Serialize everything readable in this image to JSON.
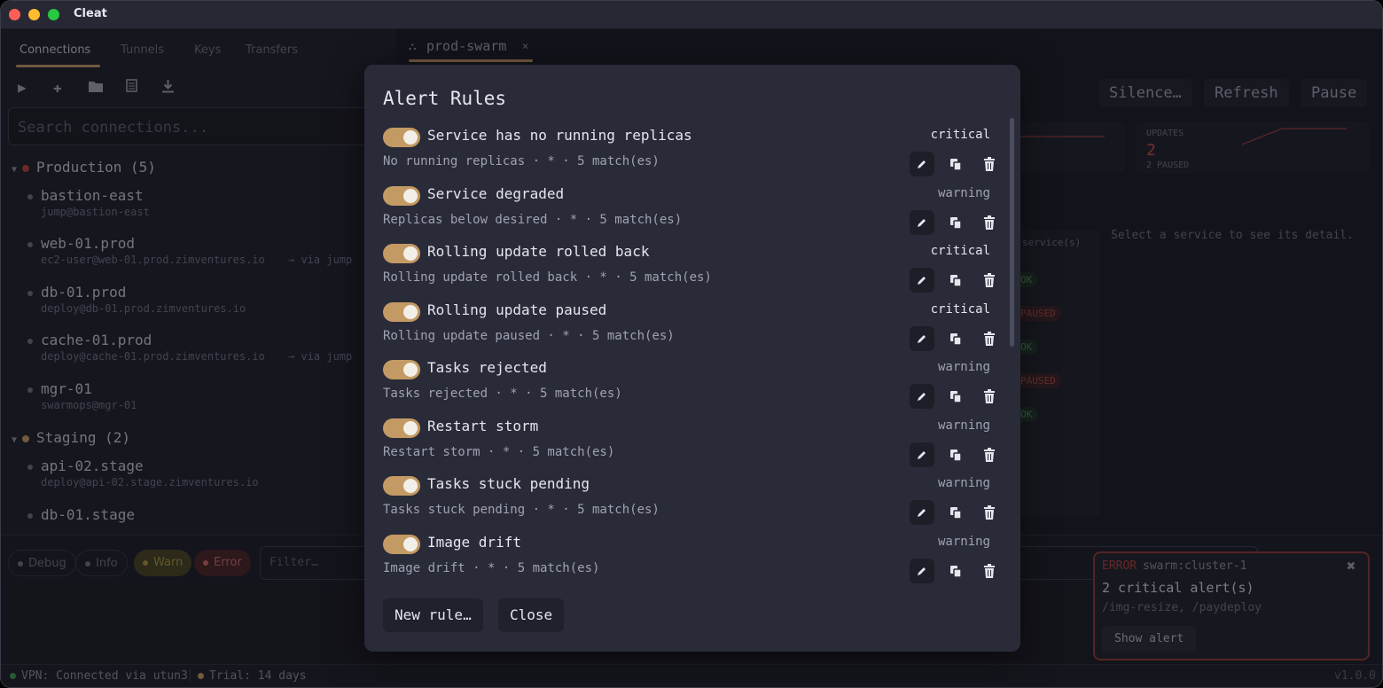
{
  "app": {
    "title": "Cleat"
  },
  "sidebar": {
    "tabs": [
      "Connections",
      "Tunnels",
      "Keys",
      "Transfers"
    ],
    "tools": [
      "play-icon",
      "plus-icon",
      "folder-icon",
      "document-icon",
      "download-icon"
    ],
    "search_placeholder": "Search connections...",
    "groups": [
      {
        "label": "Production (5)",
        "color": "#b5463f"
      },
      {
        "label": "Staging (2)",
        "color": "#c49a64"
      }
    ],
    "connections": [
      {
        "name": "bastion-east",
        "sub": "jump@bastion-east",
        "via": ""
      },
      {
        "name": "web-01.prod",
        "sub": "ec2-user@web-01.prod.zimventures.io",
        "via": "→ via jump"
      },
      {
        "name": "db-01.prod",
        "sub": "deploy@db-01.prod.zimventures.io",
        "via": ""
      },
      {
        "name": "cache-01.prod",
        "sub": "deploy@cache-01.prod.zimventures.io",
        "via": "→ via jump"
      },
      {
        "name": "mgr-01",
        "sub": "swarmops@mgr-01",
        "via": ""
      },
      {
        "name": "api-02.stage",
        "sub": "deploy@api-02.stage.zimventures.io",
        "via": ""
      },
      {
        "name": "db-01.stage",
        "sub": "",
        "via": ""
      }
    ]
  },
  "main": {
    "tab_label": "prod-swarm",
    "tab_close": "×",
    "buttons": [
      "Silence…",
      "Refresh",
      "Pause"
    ],
    "updates": {
      "label": "UPDATES",
      "value": "2",
      "sub": "2 PAUSED"
    },
    "detail_hint": "Select a service to see its detail.",
    "services_header": "service(s)",
    "badges": [
      "OK",
      "PAUSED",
      "OK",
      "PAUSED",
      "OK"
    ]
  },
  "logbar": {
    "levels": [
      "Debug",
      "Info",
      "Warn",
      "Error"
    ],
    "filter_placeholder": "Filter…"
  },
  "statusbar": {
    "vpn": "VPN: Connected via utun3",
    "trial": "Trial: 14 days",
    "version": "v1.0.0"
  },
  "toast": {
    "level": "ERROR",
    "source": "swarm:cluster-1",
    "message": "2 critical alert(s)",
    "detail": "/img-resize, /paydeploy",
    "button": "Show alert"
  },
  "modal": {
    "title": "Alert Rules",
    "rules": [
      {
        "name": "Service has no running replicas",
        "severity": "critical",
        "desc": "No running replicas · * · 5 match(es)",
        "enabled": true
      },
      {
        "name": "Service degraded",
        "severity": "warning",
        "desc": "Replicas below desired · * · 5 match(es)",
        "enabled": true
      },
      {
        "name": "Rolling update rolled back",
        "severity": "critical",
        "desc": "Rolling update rolled back · * · 5 match(es)",
        "enabled": true
      },
      {
        "name": "Rolling update paused",
        "severity": "critical",
        "desc": "Rolling update paused · * · 5 match(es)",
        "enabled": true
      },
      {
        "name": "Tasks rejected",
        "severity": "warning",
        "desc": "Tasks rejected · * · 5 match(es)",
        "enabled": true
      },
      {
        "name": "Restart storm",
        "severity": "warning",
        "desc": "Restart storm · * · 5 match(es)",
        "enabled": true
      },
      {
        "name": "Tasks stuck pending",
        "severity": "warning",
        "desc": "Tasks stuck pending · * · 5 match(es)",
        "enabled": true
      },
      {
        "name": "Image drift",
        "severity": "warning",
        "desc": "Image drift · * · 5 match(es)",
        "enabled": true
      }
    ],
    "new_rule": "New rule…",
    "close": "Close"
  },
  "colors": {
    "accent": "#c49a64",
    "critical": "#b2413c",
    "bg": "#1a1b26"
  }
}
